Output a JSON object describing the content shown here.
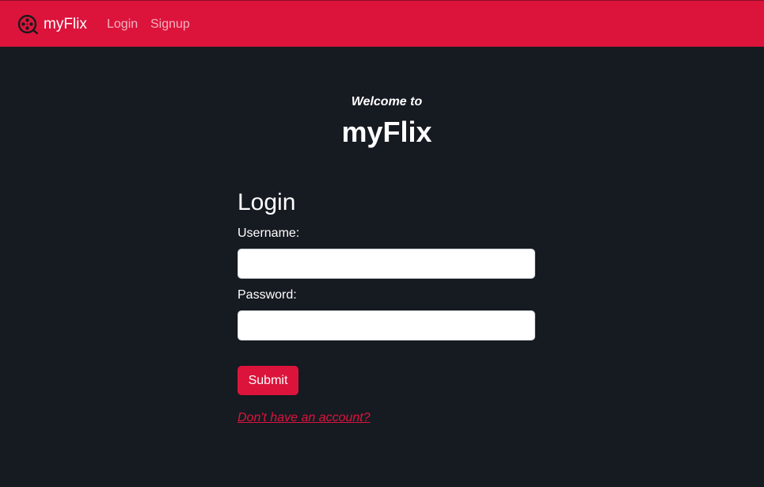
{
  "navbar": {
    "brand_name": "myFlix",
    "brand_icon": "film-reel-icon",
    "links": {
      "login": "Login",
      "signup": "Signup"
    },
    "background_color": "#dc143c"
  },
  "welcome": {
    "subtitle": "Welcome to",
    "title": "myFlix"
  },
  "login_form": {
    "title": "Login",
    "username_label": "Username:",
    "username_value": "",
    "password_label": "Password:",
    "password_value": "",
    "submit_label": "Submit",
    "signup_link": "Don't have an account?"
  },
  "colors": {
    "accent": "#dc143c",
    "page_background": "#161a21",
    "text": "#ffffff"
  }
}
